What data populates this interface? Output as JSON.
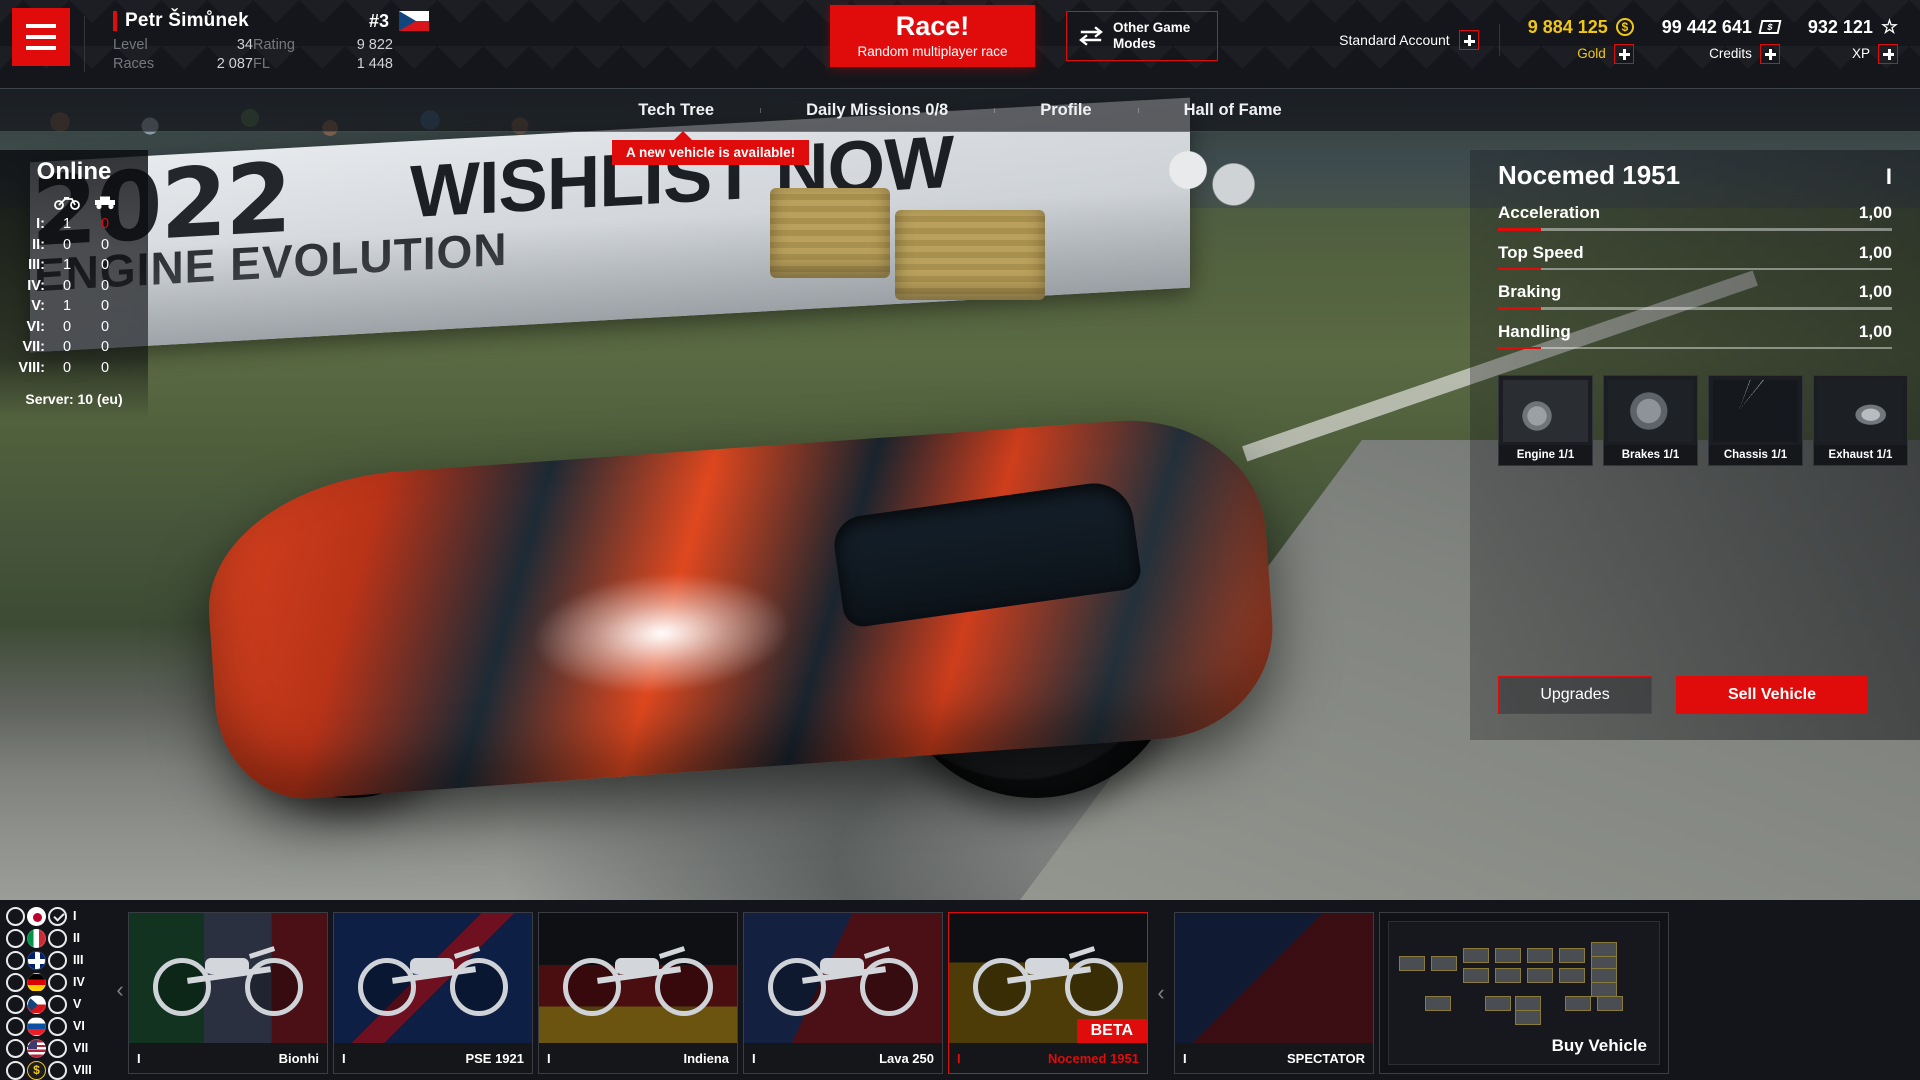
{
  "header": {
    "menu_icon": "hamburger-menu-icon",
    "player": {
      "name": "Petr Šimůnek",
      "rank": "#3",
      "flag": "czech-republic-flag",
      "level_label": "Level",
      "level_value": "34",
      "rating_label": "Rating",
      "rating_value": "9 822",
      "races_label": "Races",
      "races_value": "2 087",
      "fl_label": "FL",
      "fl_value": "1 448"
    },
    "race_button": {
      "title": "Race!",
      "subtitle": "Random multiplayer race"
    },
    "other_modes_button": {
      "label": "Other Game\nModes",
      "line1": "Other Game",
      "line2": "Modes",
      "icon": "swap-arrows-icon"
    },
    "account": {
      "label": "Standard Account",
      "plus": "+"
    },
    "currencies": [
      {
        "name": "gold",
        "value": "9 884 125",
        "label": "Gold",
        "icon": "gold-coin-icon",
        "color": "#f2c713"
      },
      {
        "name": "credits",
        "value": "99 442 641",
        "label": "Credits",
        "icon": "banknote-icon",
        "color": "#ffffff"
      },
      {
        "name": "xp",
        "value": "932 121",
        "label": "XP",
        "icon": "star-icon",
        "color": "#ffffff"
      }
    ]
  },
  "nav": {
    "tabs": [
      {
        "label": "Tech Tree"
      },
      {
        "label": "Daily Missions 0/8"
      },
      {
        "label": "Profile"
      },
      {
        "label": "Hall of Fame"
      }
    ],
    "toast": "A new vehicle is available!"
  },
  "online": {
    "title": "Online",
    "col_icons": [
      "motorcycle-icon",
      "car-icon"
    ],
    "rows": [
      {
        "tier": "I:",
        "bikes": "1",
        "cars": "0",
        "cars_highlight": true
      },
      {
        "tier": "II:",
        "bikes": "0",
        "cars": "0",
        "cars_highlight": false
      },
      {
        "tier": "III:",
        "bikes": "1",
        "cars": "0",
        "cars_highlight": false
      },
      {
        "tier": "IV:",
        "bikes": "0",
        "cars": "0",
        "cars_highlight": false
      },
      {
        "tier": "V:",
        "bikes": "1",
        "cars": "0",
        "cars_highlight": false
      },
      {
        "tier": "VI:",
        "bikes": "0",
        "cars": "0",
        "cars_highlight": false
      },
      {
        "tier": "VII:",
        "bikes": "0",
        "cars": "0",
        "cars_highlight": false
      },
      {
        "tier": "VIII:",
        "bikes": "0",
        "cars": "0",
        "cars_highlight": false
      }
    ],
    "server_label": "Server:",
    "server_value": "10 (eu)"
  },
  "vehicle": {
    "name": "Nocemed 1951",
    "tier": "I",
    "stats": [
      {
        "label": "Acceleration",
        "value": "1,00",
        "fill_pct": 11
      },
      {
        "label": "Top Speed",
        "value": "1,00",
        "fill_pct": 11
      },
      {
        "label": "Braking",
        "value": "1,00",
        "fill_pct": 11
      },
      {
        "label": "Handling",
        "value": "1,00",
        "fill_pct": 11
      }
    ],
    "upgrades": [
      {
        "label": "Engine 1/1",
        "icon": "engine-icon"
      },
      {
        "label": "Brakes 1/1",
        "icon": "brake-disc-icon"
      },
      {
        "label": "Chassis 1/1",
        "icon": "chassis-icon"
      },
      {
        "label": "Exhaust 1/1",
        "icon": "exhaust-icon"
      }
    ],
    "upgrades_button": "Upgrades",
    "sell_button": "Sell Vehicle"
  },
  "garage": {
    "filters": {
      "countries": [
        "japan-flag",
        "italy-flag",
        "united-kingdom-flag",
        "germany-flag",
        "czech-republic-flag",
        "slovakia-flag",
        "usa-flag",
        "gold-coin-icon"
      ],
      "tiers": [
        {
          "label": "I",
          "checked": true
        },
        {
          "label": "II",
          "checked": false
        },
        {
          "label": "III",
          "checked": false
        },
        {
          "label": "IV",
          "checked": false
        },
        {
          "label": "V",
          "checked": false
        },
        {
          "label": "VI",
          "checked": false
        },
        {
          "label": "VII",
          "checked": false
        },
        {
          "label": "VIII",
          "checked": false
        }
      ]
    },
    "cards": [
      {
        "tier": "I",
        "name": "Bionhi",
        "bg": "bg-jp",
        "selected": false,
        "badge": ""
      },
      {
        "tier": "I",
        "name": "PSE 1921",
        "bg": "bg-gb",
        "selected": false,
        "badge": ""
      },
      {
        "tier": "I",
        "name": "Indiena",
        "bg": "bg-de",
        "selected": false,
        "badge": ""
      },
      {
        "tier": "I",
        "name": "Lava 250",
        "bg": "bg-cz",
        "selected": false,
        "badge": ""
      },
      {
        "tier": "I",
        "name": "Nocemed 1951",
        "bg": "bg-sel",
        "selected": true,
        "badge": "BETA"
      },
      {
        "tier": "I",
        "name": "SPECTATOR",
        "bg": "bg-spec",
        "selected": false,
        "badge": ""
      }
    ],
    "buy_card": {
      "label": "Buy Vehicle"
    },
    "prev_arrow": "chevron-left-icon",
    "next_arrow": "chevron-right-icon"
  }
}
